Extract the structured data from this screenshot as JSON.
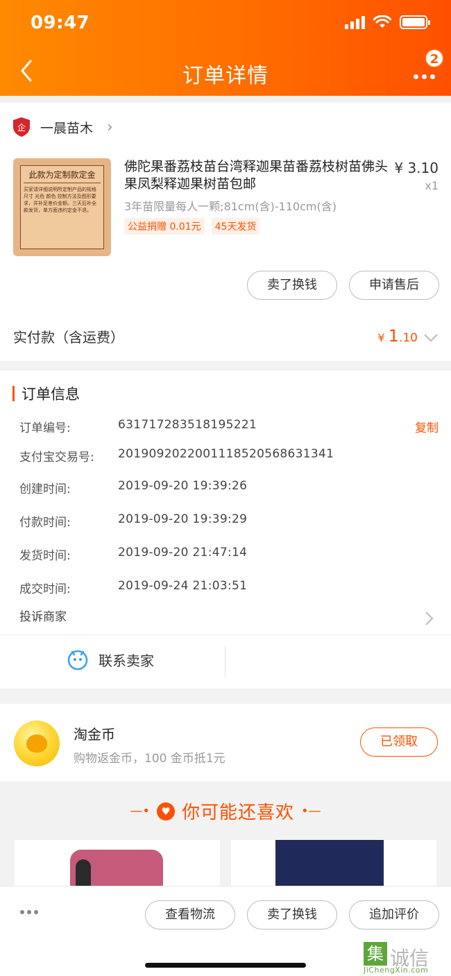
{
  "status_bar": {
    "time": "09:47"
  },
  "nav": {
    "title": "订单详情",
    "more_badge": "2"
  },
  "shop": {
    "name": "一晨苗木"
  },
  "product": {
    "image_title": "此款为定制款定金",
    "image_text": "买家请详细说明所定制产品的规格尺寸 光色 颜色 控制方法及图形要求，并补足差价金额。三天后补全款发货，单方面违约定金不退。",
    "title": "佛陀果番荔枝苗台湾释迦果苗番荔枝树苗佛头果凤梨释迦果树苗包邮",
    "price": "¥ 3.10",
    "qty": "x1",
    "spec": "3年苗限量每人一颗;81cm(含)-110cm(含)",
    "tags": [
      "公益捐赠 0.01元",
      "45天发货"
    ]
  },
  "actions": {
    "sell": "卖了换钱",
    "after_sale": "申请售后"
  },
  "payment": {
    "label": "实付款（含运费）",
    "currency": "¥ ",
    "amount_int": "1",
    "amount_dec": ".10"
  },
  "order_info": {
    "title": "订单信息",
    "copy": "复制",
    "rows": [
      {
        "label": "订单编号:",
        "value": "631717283518195221"
      },
      {
        "label": "支付宝交易号:",
        "value": "2019092022001118520568631341"
      },
      {
        "label": "创建时间:",
        "value": "2019-09-20 19:39:26"
      },
      {
        "label": "付款时间:",
        "value": "2019-09-20 19:39:29"
      },
      {
        "label": "发货时间:",
        "value": "2019-09-20 21:47:14"
      },
      {
        "label": "成交时间:",
        "value": "2019-09-24 21:03:51"
      }
    ],
    "complain": "投诉商家",
    "contact": "联系卖家"
  },
  "coins": {
    "title": "淘金币",
    "sub": "购物返金币，100 金币抵1元",
    "button": "已领取"
  },
  "recommend": {
    "title": "你可能还喜欢"
  },
  "bottom": {
    "logistics": "查看物流",
    "sell": "卖了换钱",
    "review": "追加评价"
  },
  "watermark": {
    "mark": "集",
    "text": "诚信",
    "sub": "JiChengXin.com"
  },
  "colors": {
    "accent": "#ff5000",
    "header_start": "#ff8a00",
    "header_end": "#ff5000"
  }
}
